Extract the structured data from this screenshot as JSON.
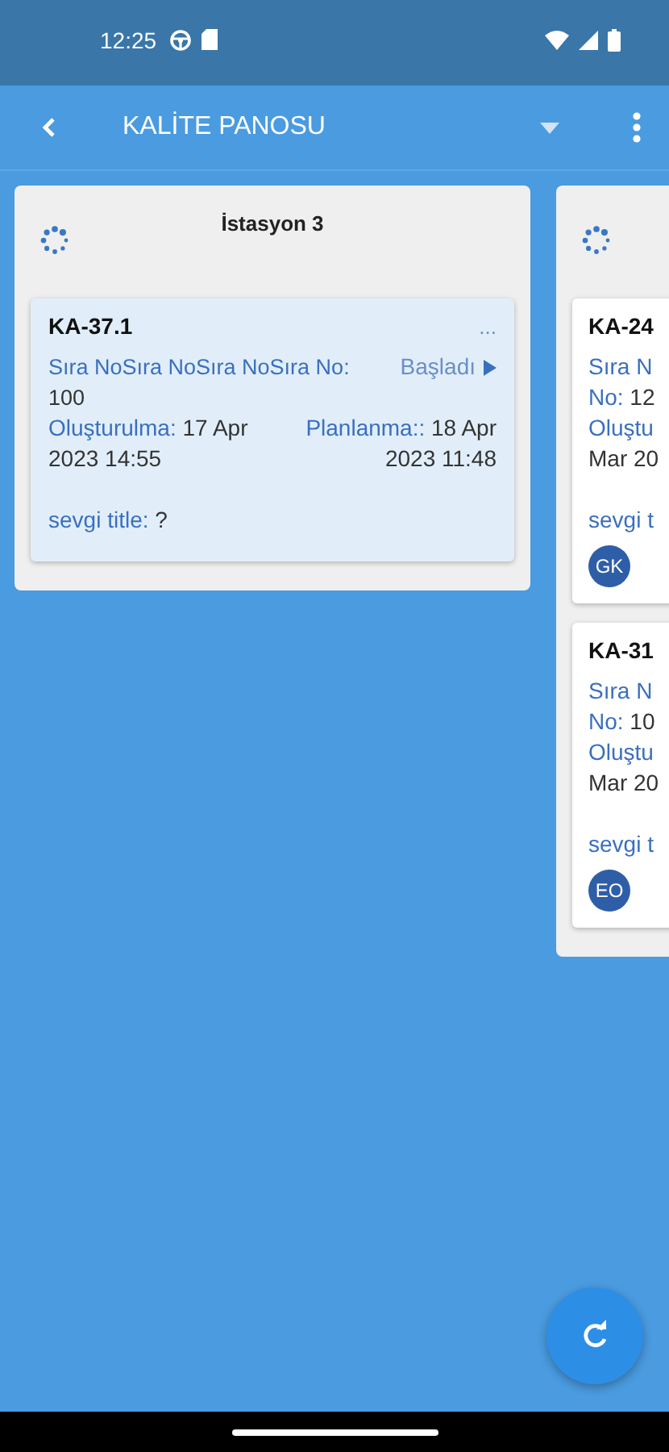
{
  "status_bar": {
    "time": "12:25"
  },
  "app_bar": {
    "title": "KALİTE PANOSU"
  },
  "columns": [
    {
      "title": "İstasyon 3",
      "cards": [
        {
          "kind": "full",
          "id": "KA-37.1",
          "more": "...",
          "order_label": "Sıra NoSıra NoSıra NoSıra No:",
          "order_value": "100",
          "status": "Başladı",
          "created_label": "Oluşturulma:",
          "created_value": "17 Apr 2023 14:55",
          "planned_label": "Planlanma::",
          "planned_value": "18 Apr 2023 11:48",
          "title_label": "sevgi title:",
          "title_value": "?"
        }
      ]
    },
    {
      "cards": [
        {
          "kind": "clipped",
          "id": "KA-24",
          "order_label": "Sıra N",
          "order2_label": "No:",
          "order2_value": "12",
          "created_label": "Oluştu",
          "created_value": "Mar 20",
          "title_label": "sevgi t",
          "avatar": "GK"
        },
        {
          "kind": "clipped",
          "id": "KA-31",
          "order_label": "Sıra N",
          "order2_label": "No:",
          "order2_value": "10",
          "created_label": "Oluştu",
          "created_value": "Mar 20",
          "title_label": "sevgi t",
          "avatar": "EO"
        }
      ]
    }
  ]
}
